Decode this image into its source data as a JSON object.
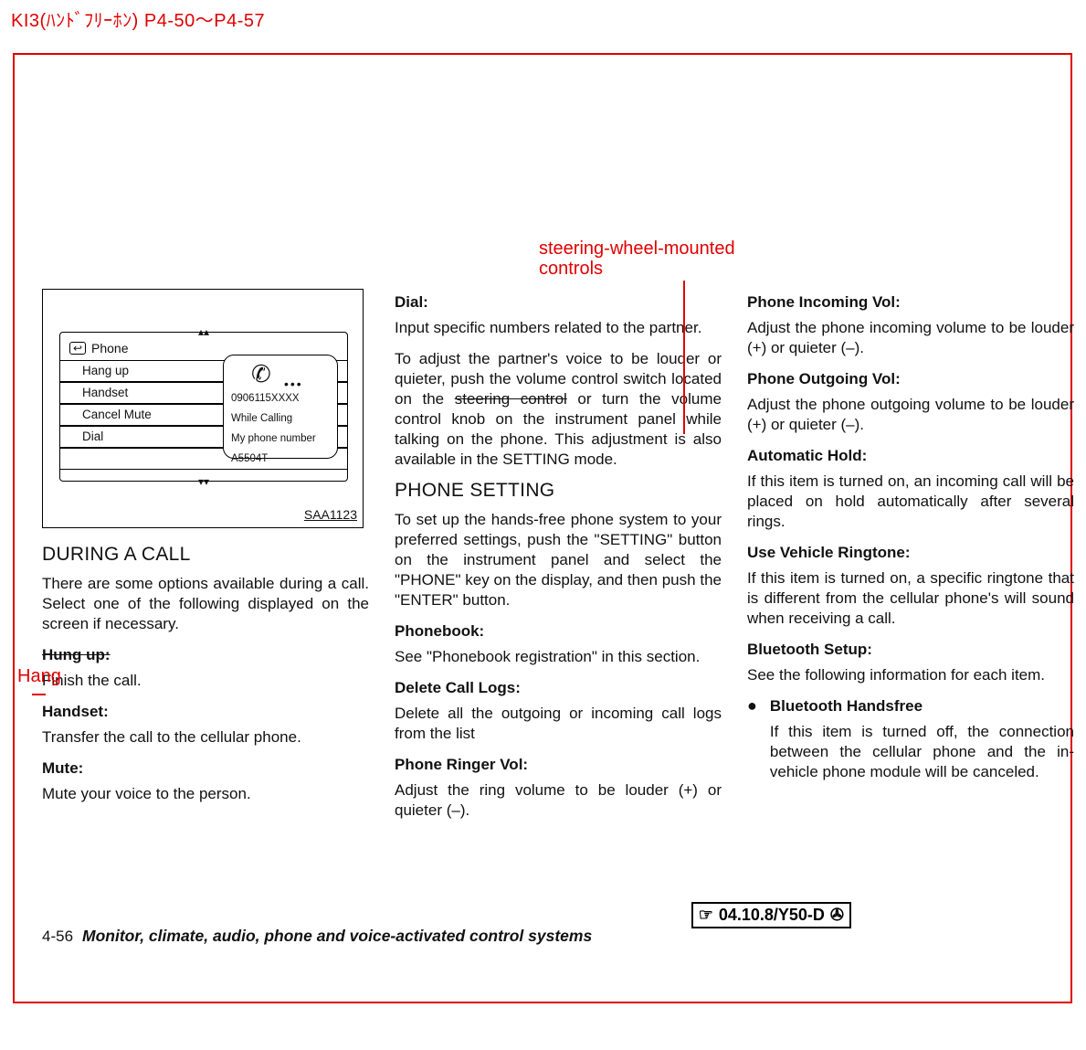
{
  "header": "KI3(ﾊﾝﾄﾞﾌﾘｰﾎﾝ) P4-50～P4-57",
  "annotations": {
    "steering": "steering-wheel-mounted\ncontrols",
    "hang": "Hang"
  },
  "figure": {
    "id": "SAA1123",
    "header_label": "Phone",
    "menu": [
      "Hang up",
      "Handset",
      "Cancel Mute",
      "Dial"
    ],
    "box": {
      "line1": "0906115XXXX",
      "line2": "While Calling",
      "line3": "My phone number",
      "line4": "A5504T"
    }
  },
  "col1": {
    "h1": "DURING A CALL",
    "p1": "There are some options available during a call. Select one of the following displayed on the screen if necessary.",
    "b1": "Hung up:",
    "p2": "Finish the call.",
    "b2": "Handset:",
    "p3": "Transfer the call to the cellular phone.",
    "b3": "Mute:",
    "p4": "Mute your voice to the person."
  },
  "col2": {
    "b1": "Dial:",
    "p1": "Input specific numbers related to the partner.",
    "p2a": "To adjust the partner's voice to be louder or quieter, push the volume control switch located on the ",
    "p2strike": "steering control",
    "p2b": " or turn the volume control knob on the in­strument panel while talking on the phone. This adjustment is also available in the SETTING mode.",
    "h1": "PHONE SETTING",
    "p3": "To set up the hands-free phone system to your preferred settings, push the \"SET­TING\" button on the instrument panel and select the \"PHONE\" key on the display, and then push the \"ENTER\" button.",
    "b2": "Phonebook:",
    "p4": "See \"Phonebook registration\" in this sec­tion.",
    "b3": "Delete Call Logs:",
    "p5": "Delete all the outgoing or incoming call logs from the list",
    "b4": "Phone Ringer Vol:",
    "p6": "Adjust the ring volume to be louder (+) or quieter (–)."
  },
  "col3": {
    "b1": "Phone Incoming Vol:",
    "p1": "Adjust the phone incoming volume to be louder (+) or quieter (–).",
    "b2": "Phone Outgoing Vol:",
    "p2": "Adjust the phone outgoing volume to be louder (+) or quieter (–).",
    "b3": "Automatic Hold:",
    "p3": "If this item is turned on, an incoming call will be placed on hold automatically after several rings.",
    "b4": "Use Vehicle Ringtone:",
    "p4": "If this item is turned on, a specific ring­tone that is different from the cellular phone's will sound when receiving a call.",
    "b5": "Bluetooth Setup:",
    "p5": "See the following information for each item.",
    "bullet_b": "Bluetooth Handsfree",
    "bullet_p": "If this item is turned off, the connec­tion between the cellular phone and the in-vehicle phone module will be canceled."
  },
  "footer": {
    "page": "4-56",
    "title": "Monitor, climate, audio, phone and voice-activated control systems"
  },
  "stamp": {
    "left": "☞",
    "text": "04.10.8/Y50-D",
    "right": "✇"
  }
}
